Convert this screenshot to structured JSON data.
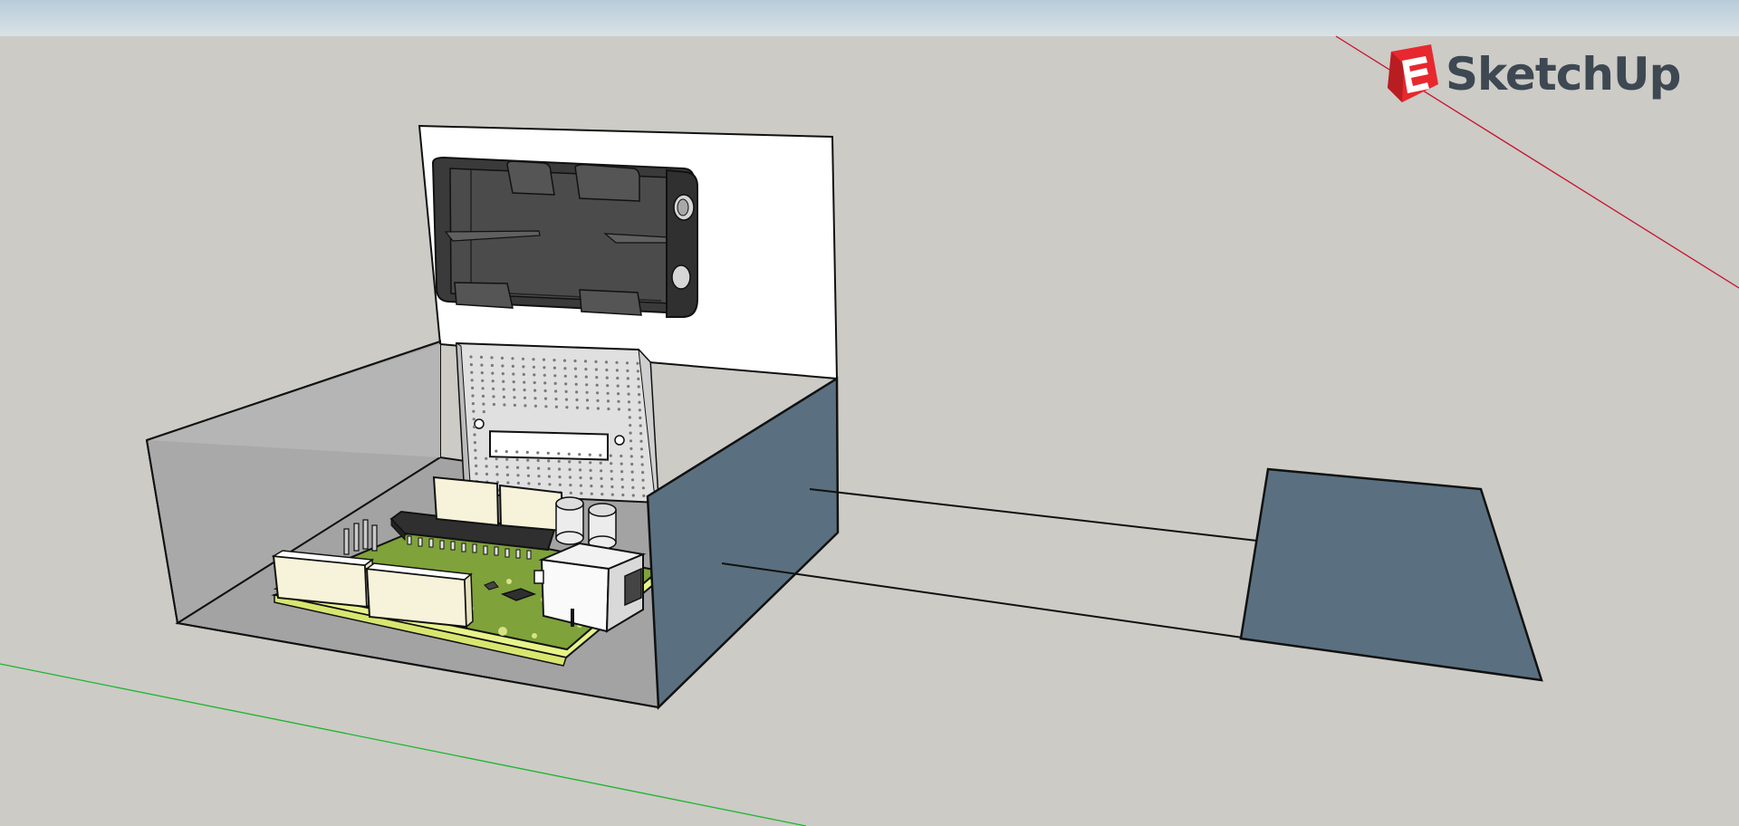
{
  "app": {
    "logo_text": "SketchUp"
  },
  "colors": {
    "sky": "#c7d6de",
    "ground": "#cccbc6",
    "x_axis": "#c8102e",
    "y_axis": "#1db52e",
    "box_outer": "#5a7080",
    "box_inner": "#a4a4a4",
    "pcb": "#7fa23a",
    "logo_red": "#e7282e",
    "logo_text": "#3d4852"
  },
  "icons": {
    "logo": "sketchup-logo-icon"
  }
}
